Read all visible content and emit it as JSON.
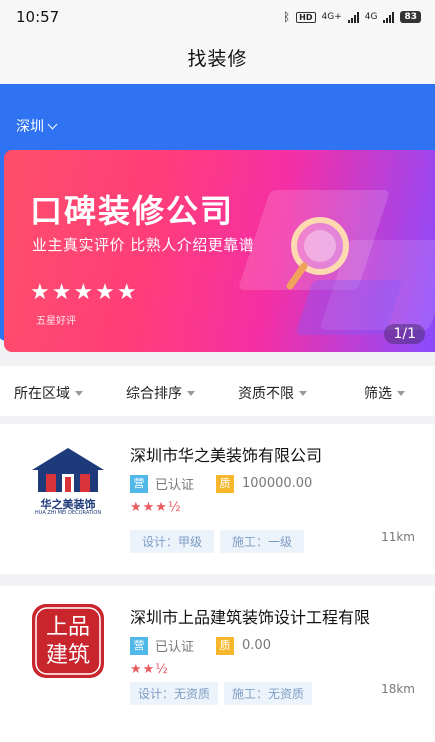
{
  "status": {
    "time": "10:57",
    "battery": "83",
    "hd": "HD",
    "net1": "4G+",
    "net2": "4G"
  },
  "nav": {
    "title": "找装修"
  },
  "location": {
    "city": "深圳"
  },
  "banner": {
    "title": "口碑装修公司",
    "subtitle": "业主真实评价 比熟人介绍更靠谱",
    "stars": "★★★★★",
    "caption": "五星好评",
    "counter": "1/1"
  },
  "filters": [
    {
      "label": "所在区域"
    },
    {
      "label": "综合排序"
    },
    {
      "label": "资质不限"
    },
    {
      "label": "筛选"
    }
  ],
  "companies": [
    {
      "name": "深圳市华之美装饰有限公司",
      "logo_text": "华之美装饰",
      "logo_sub": "HUA ZHI MEI DECORATION",
      "ying": "营",
      "certified": "已认证",
      "zi": "质",
      "capital": "100000.00",
      "rating_stars": "★★★½",
      "rating": 3.5,
      "design": "设计：甲级",
      "construction": "施工：一级",
      "distance": "11km"
    },
    {
      "name": "深圳市上品建筑装饰设计工程有限",
      "logo_text": "上品建筑",
      "ying": "营",
      "certified": "已认证",
      "zi": "质",
      "capital": "0.00",
      "rating_stars": "★★½",
      "rating": 2.5,
      "design": "设计：无资质",
      "construction": "施工：无资质",
      "distance": "18km"
    }
  ]
}
